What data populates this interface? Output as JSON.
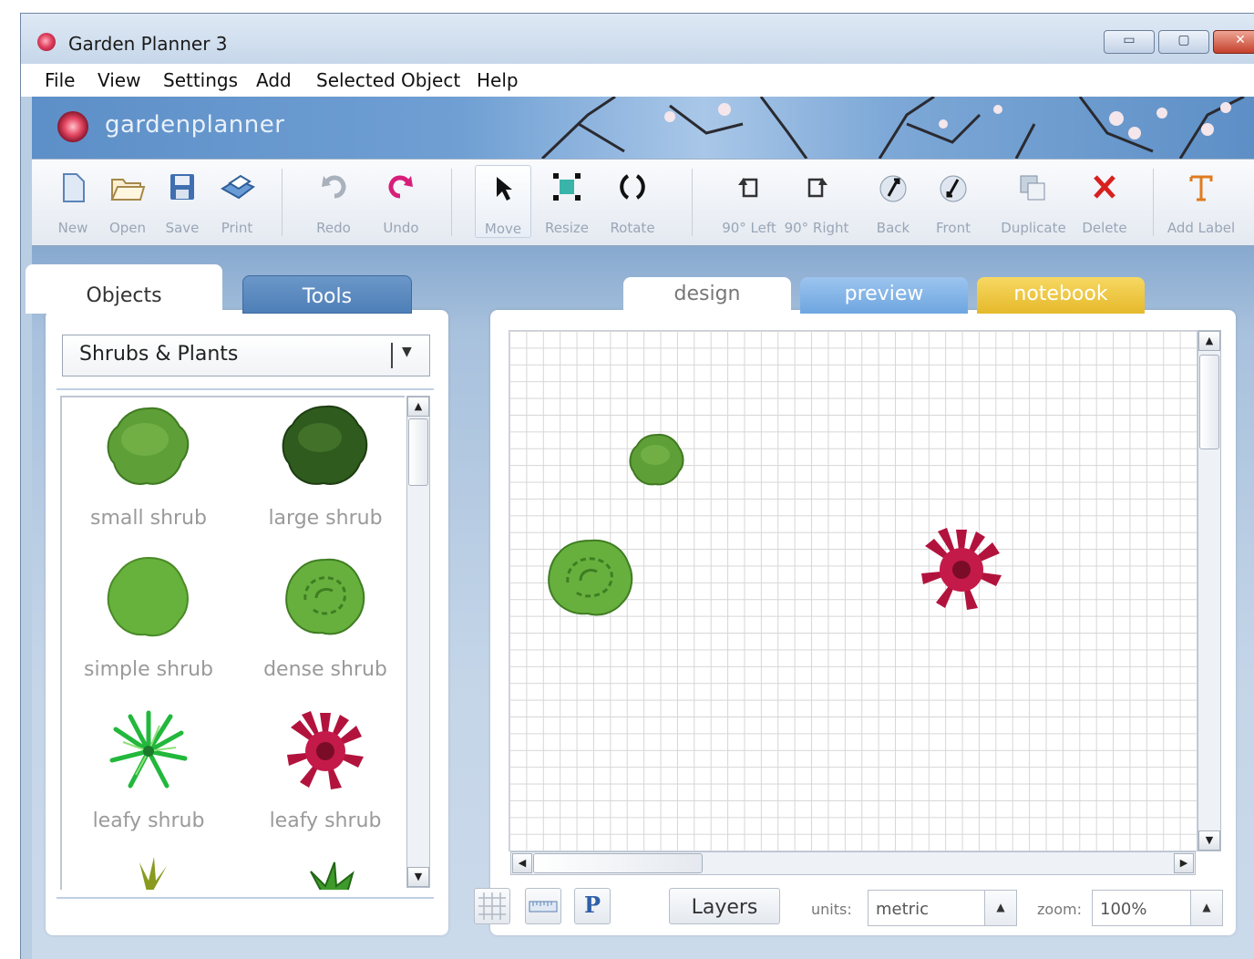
{
  "window": {
    "title": "Garden Planner 3",
    "min": "▭",
    "max": "▢",
    "close": "✕"
  },
  "menu": [
    "File",
    "View",
    "Settings",
    "Add",
    "Selected Object",
    "Help"
  ],
  "brand": {
    "name": "gardenplanner"
  },
  "toolbar": {
    "new": "New",
    "open": "Open",
    "save": "Save",
    "print": "Print",
    "redo": "Redo",
    "undo": "Undo",
    "move": "Move",
    "resize": "Resize",
    "rotate": "Rotate",
    "left90": "90° Left",
    "right90": "90° Right",
    "back": "Back",
    "front": "Front",
    "duplicate": "Duplicate",
    "delete": "Delete",
    "add_label": "Add Label"
  },
  "left_panel": {
    "tabs": [
      "Objects",
      "Tools"
    ],
    "category": "Shrubs & Plants",
    "objects": [
      "small shrub",
      "large shrub",
      "simple shrub",
      "dense shrub",
      "leafy shrub",
      "leafy shrub"
    ]
  },
  "view_tabs": [
    "design",
    "preview",
    "notebook"
  ],
  "bottom": {
    "grid_icon": "grid-icon",
    "ruler_icon": "ruler-icon",
    "p_button": "P",
    "layers": "Layers",
    "units_label": "units:",
    "units_value": "metric",
    "zoom_label": "zoom:",
    "zoom_value": "100%"
  },
  "colors": {
    "accent_blue": "#5a8bc5",
    "notebook_yellow": "#e8bd2f",
    "close_red": "#c8442e",
    "delete_red": "#d8201f"
  }
}
